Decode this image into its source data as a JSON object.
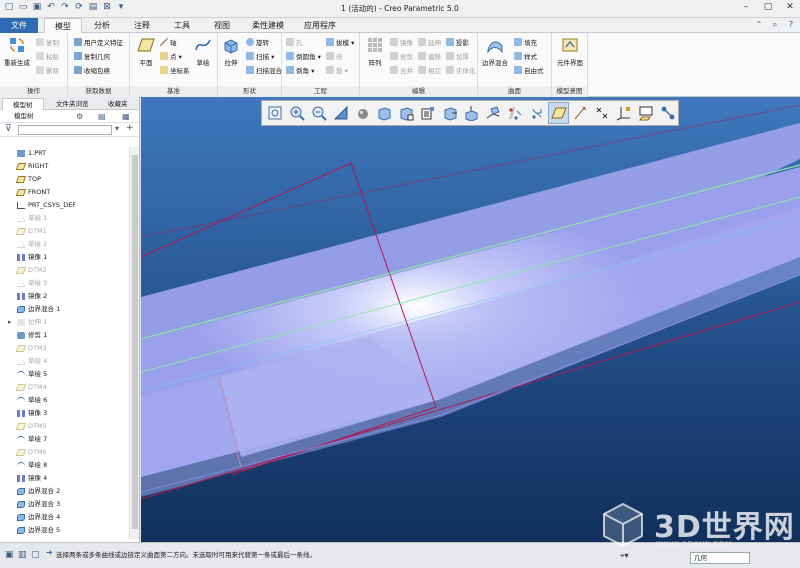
{
  "window": {
    "title": "1 (活动的) - Creo Parametric 5.0",
    "quick_access_icons": [
      "new-icon",
      "open-icon",
      "save-icon",
      "undo-icon",
      "redo-icon",
      "regenerate-icon",
      "windows-icon",
      "close-window-icon",
      "customize-icon"
    ]
  },
  "tabs": [
    "文件",
    "模型",
    "分析",
    "注释",
    "工具",
    "视图",
    "柔性建模",
    "应用程序"
  ],
  "active_tab": "模型",
  "ribbon": {
    "operations": {
      "label": "操作",
      "regenerate": "重新生成",
      "copy": "复制",
      "paste": "粘贴",
      "delete": "删除"
    },
    "get_data": {
      "label": "获取数据",
      "udf": "用户定义特征",
      "copy_geom": "复制几何",
      "shrinkwrap": "收缩包络"
    },
    "datum": {
      "label": "基准",
      "plane": "平面",
      "axis": "轴",
      "point": "点",
      "csys": "坐标系",
      "sketch": "草绘"
    },
    "shapes": {
      "label": "形状",
      "extrude": "拉伸",
      "revolve": "旋转",
      "sweep": "扫描",
      "swept_blend": "扫描混合"
    },
    "engineering": {
      "label": "工程",
      "hole": "孔",
      "round": "倒圆角",
      "chamfer": "倒角",
      "draft": "拔模",
      "shell": "壳",
      "rib": "筋"
    },
    "editing": {
      "label": "编辑",
      "pattern": "阵列",
      "mirror": "镜像",
      "extend": "延伸",
      "project": "投影",
      "trim": "修剪",
      "offset": "偏移",
      "thicken": "加厚",
      "merge": "合并",
      "intersect": "相交",
      "solidify": "实体化"
    },
    "surfaces": {
      "label": "曲面",
      "boundary_blend": "边界混合",
      "fill": "填充",
      "style": "样式",
      "freestyle": "自由式"
    },
    "model_intent": {
      "label": "模型意图",
      "component_interface": "元件界面"
    }
  },
  "left_panel": {
    "tabs": [
      "模型树",
      "文件夹浏览",
      "收藏夹"
    ],
    "header": "模型树",
    "items": [
      {
        "label": "1.PRT",
        "icon": "part-icon",
        "gray": false
      },
      {
        "label": "RIGHT",
        "icon": "datum-plane-icon",
        "gray": false
      },
      {
        "label": "TOP",
        "icon": "datum-plane-icon",
        "gray": false
      },
      {
        "label": "FRONT",
        "icon": "datum-plane-icon",
        "gray": false
      },
      {
        "label": "PRT_CSYS_DEF",
        "icon": "csys-icon",
        "gray": false
      },
      {
        "label": "草绘 1",
        "icon": "sketch-icon",
        "gray": true
      },
      {
        "label": "DTM1",
        "icon": "datum-plane-icon",
        "gray": true
      },
      {
        "label": "草绘 2",
        "icon": "sketch-icon",
        "gray": true
      },
      {
        "label": "镜像 1",
        "icon": "mirror-icon",
        "gray": false
      },
      {
        "label": "DTM2",
        "icon": "datum-plane-icon",
        "gray": true
      },
      {
        "label": "草绘 3",
        "icon": "sketch-icon",
        "gray": true
      },
      {
        "label": "镜像 2",
        "icon": "mirror-icon",
        "gray": false
      },
      {
        "label": "边界混合 1",
        "icon": "boundary-blend-icon",
        "gray": false
      },
      {
        "label": "拉伸 1",
        "icon": "extrude-icon",
        "gray": true
      },
      {
        "label": "修剪 1",
        "icon": "trim-icon",
        "gray": false
      },
      {
        "label": "DTM3",
        "icon": "datum-plane-icon",
        "gray": true
      },
      {
        "label": "草绘 4",
        "icon": "sketch-icon",
        "gray": true
      },
      {
        "label": "草绘 5",
        "icon": "sketch-curve-icon",
        "gray": false
      },
      {
        "label": "DTM4",
        "icon": "datum-plane-icon",
        "gray": true
      },
      {
        "label": "草绘 6",
        "icon": "sketch-curve-icon",
        "gray": false
      },
      {
        "label": "镜像 3",
        "icon": "mirror-icon",
        "gray": false
      },
      {
        "label": "DTM5",
        "icon": "datum-plane-icon",
        "gray": true
      },
      {
        "label": "草绘 7",
        "icon": "sketch-curve-icon",
        "gray": false
      },
      {
        "label": "DTM6",
        "icon": "datum-plane-icon",
        "gray": true
      },
      {
        "label": "草绘 8",
        "icon": "sketch-curve-icon",
        "gray": false
      },
      {
        "label": "镜像 4",
        "icon": "mirror-icon",
        "gray": false
      },
      {
        "label": "边界混合 2",
        "icon": "boundary-blend-icon",
        "gray": false
      },
      {
        "label": "边界混合 3",
        "icon": "boundary-blend-icon",
        "gray": false
      },
      {
        "label": "边界混合 4",
        "icon": "boundary-blend-icon",
        "gray": false
      },
      {
        "label": "边界混合 5",
        "icon": "boundary-blend-icon",
        "gray": false
      }
    ]
  },
  "status_bar": {
    "message": "选择两条或多条曲线或边链定义曲面第二方向。未选取时可用来代替第一条或最后一条线。",
    "filter_value": "几何"
  },
  "watermark": {
    "text": "3D世界网",
    "url": "WWW.3DSJW.COM"
  },
  "colors": {
    "accent": "#2e6bb3",
    "surface": "#aab0f0",
    "curve": "#7ee0a0",
    "datum": "#b01850"
  }
}
